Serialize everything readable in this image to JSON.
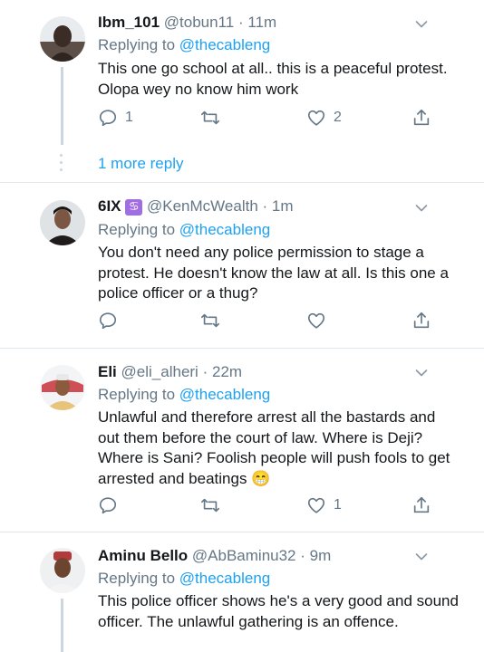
{
  "replies": [
    {
      "display_name": "Ibm_101",
      "handle": "@tobun11",
      "separator": "·",
      "time": "11m",
      "replying_prefix": "Replying to",
      "replying_to": "@thecableng",
      "text": "This one go school at all.. this is a peaceful protest. Olopa wey no know him work",
      "reply_count": "1",
      "like_count": "2"
    },
    {
      "display_name": "6IX",
      "badge": "♋",
      "handle": "@KenMcWealth",
      "separator": "·",
      "time": "1m",
      "replying_prefix": "Replying to",
      "replying_to": "@thecableng",
      "text": "You don't need any police permission to stage a protest. He doesn't know the law at all. Is this one a police officer or a thug?",
      "reply_count": "",
      "like_count": ""
    },
    {
      "display_name": "Eli",
      "handle": "@eli_alheri",
      "separator": "·",
      "time": "22m",
      "replying_prefix": "Replying to",
      "replying_to": "@thecableng",
      "text": "Unlawful and therefore arrest all the bastards and out them before the court of law. Where is Deji? Where is Sani? Foolish people will push fools to get arrested and beatings 😁",
      "reply_count": "",
      "like_count": "1"
    },
    {
      "display_name": "Aminu Bello",
      "handle": "@AbBaminu32",
      "separator": "·",
      "time": "9m",
      "replying_prefix": "Replying to",
      "replying_to": "@thecableng",
      "text": "This police officer shows he's a very good and sound officer. The unlawful gathering is an offence.",
      "reply_count": "",
      "like_count": ""
    }
  ],
  "more_replies_label": "1 more reply",
  "colors": {
    "accent": "#1da1f2",
    "secondary_text": "#657786",
    "primary_text": "#14171a",
    "divider": "#e1e8ed"
  },
  "icons": [
    "chevron-down-icon",
    "reply-icon",
    "retweet-icon",
    "like-icon",
    "share-icon"
  ]
}
